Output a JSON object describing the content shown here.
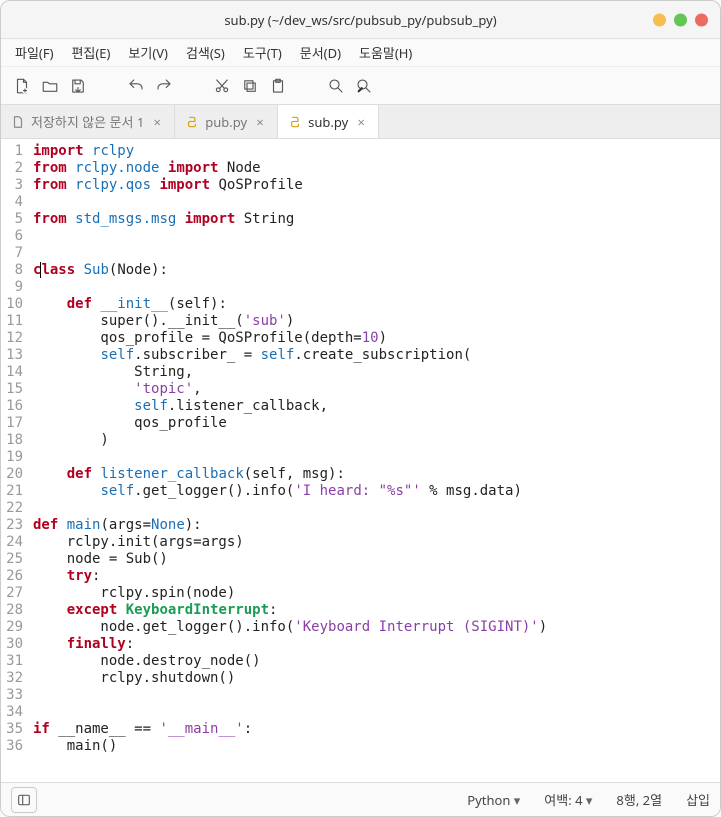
{
  "window": {
    "title": "sub.py (~/dev_ws/src/pubsub_py/pubsub_py)"
  },
  "menu": {
    "file": "파일(F)",
    "edit": "편집(E)",
    "view": "보기(V)",
    "search": "검색(S)",
    "tools": "도구(T)",
    "docs": "문서(D)",
    "help": "도움말(H)"
  },
  "tabs": {
    "t0": {
      "label": "저장하지 않은 문서 1"
    },
    "t1": {
      "label": "pub.py"
    },
    "t2": {
      "label": "sub.py"
    }
  },
  "status": {
    "language": "Python",
    "indent": "여백: 4",
    "position": "8행, 2열",
    "mode": "삽입"
  },
  "code": {
    "lines": [
      [
        [
          "kw",
          "import"
        ],
        [
          "op",
          " "
        ],
        [
          "fn",
          "rclpy"
        ]
      ],
      [
        [
          "kw",
          "from"
        ],
        [
          "op",
          " "
        ],
        [
          "fn",
          "rclpy.node"
        ],
        [
          "op",
          " "
        ],
        [
          "kw",
          "import"
        ],
        [
          "op",
          " Node"
        ]
      ],
      [
        [
          "kw",
          "from"
        ],
        [
          "op",
          " "
        ],
        [
          "fn",
          "rclpy.qos"
        ],
        [
          "op",
          " "
        ],
        [
          "kw",
          "import"
        ],
        [
          "op",
          " QoSProfile"
        ]
      ],
      [],
      [
        [
          "kw",
          "from"
        ],
        [
          "op",
          " "
        ],
        [
          "fn",
          "std_msgs.msg"
        ],
        [
          "op",
          " "
        ],
        [
          "kw",
          "import"
        ],
        [
          "op",
          " String"
        ]
      ],
      [],
      [],
      [
        [
          "kw",
          "c"
        ],
        [
          "caret",
          ""
        ],
        [
          "kw",
          "lass"
        ],
        [
          "op",
          " "
        ],
        [
          "fn",
          "Sub"
        ],
        [
          "op",
          "(Node):"
        ]
      ],
      [],
      [
        [
          "op",
          "    "
        ],
        [
          "kw",
          "def"
        ],
        [
          "op",
          " "
        ],
        [
          "fn",
          "__init__"
        ],
        [
          "op",
          "(self):"
        ]
      ],
      [
        [
          "op",
          "        super().__init__("
        ],
        [
          "str",
          "'sub'"
        ],
        [
          "op",
          ")"
        ]
      ],
      [
        [
          "op",
          "        qos_profile = QoSProfile(depth="
        ],
        [
          "num",
          "10"
        ],
        [
          "op",
          ")"
        ]
      ],
      [
        [
          "op",
          "        "
        ],
        [
          "fn",
          "self"
        ],
        [
          "op",
          ".subscriber_ = "
        ],
        [
          "fn",
          "self"
        ],
        [
          "op",
          ".create_subscription("
        ]
      ],
      [
        [
          "op",
          "            String,"
        ]
      ],
      [
        [
          "op",
          "            "
        ],
        [
          "str",
          "'topic'"
        ],
        [
          "op",
          ","
        ]
      ],
      [
        [
          "op",
          "            "
        ],
        [
          "fn",
          "self"
        ],
        [
          "op",
          ".listener_callback,"
        ]
      ],
      [
        [
          "op",
          "            qos_profile"
        ]
      ],
      [
        [
          "op",
          "        )"
        ]
      ],
      [],
      [
        [
          "op",
          "    "
        ],
        [
          "kw",
          "def"
        ],
        [
          "op",
          " "
        ],
        [
          "fn",
          "listener_callback"
        ],
        [
          "op",
          "(self, msg):"
        ]
      ],
      [
        [
          "op",
          "        "
        ],
        [
          "fn",
          "self"
        ],
        [
          "op",
          ".get_logger().info("
        ],
        [
          "str",
          "'I heard: \"%s\"'"
        ],
        [
          "op",
          " % msg.data)"
        ]
      ],
      [],
      [
        [
          "kw",
          "def"
        ],
        [
          "op",
          " "
        ],
        [
          "fn",
          "main"
        ],
        [
          "op",
          "(args="
        ],
        [
          "fn",
          "None"
        ],
        [
          "op",
          "):"
        ]
      ],
      [
        [
          "op",
          "    rclpy.init(args=args)"
        ]
      ],
      [
        [
          "op",
          "    node = Sub()"
        ]
      ],
      [
        [
          "op",
          "    "
        ],
        [
          "kw",
          "try"
        ],
        [
          "op",
          ":"
        ]
      ],
      [
        [
          "op",
          "        rclpy.spin(node)"
        ]
      ],
      [
        [
          "op",
          "    "
        ],
        [
          "kw",
          "except"
        ],
        [
          "op",
          " "
        ],
        [
          "cls",
          "KeyboardInterrupt"
        ],
        [
          "op",
          ":"
        ]
      ],
      [
        [
          "op",
          "        node.get_logger().info("
        ],
        [
          "str",
          "'Keyboard Interrupt (SIGINT)'"
        ],
        [
          "op",
          ")"
        ]
      ],
      [
        [
          "op",
          "    "
        ],
        [
          "kw",
          "finally"
        ],
        [
          "op",
          ":"
        ]
      ],
      [
        [
          "op",
          "        node.destroy_node()"
        ]
      ],
      [
        [
          "op",
          "        rclpy.shutdown()"
        ]
      ],
      [],
      [],
      [
        [
          "kw",
          "if"
        ],
        [
          "op",
          " __name__ == "
        ],
        [
          "str",
          "'__main__'"
        ],
        [
          "op",
          ":"
        ]
      ],
      [
        [
          "op",
          "    main()"
        ]
      ]
    ]
  }
}
